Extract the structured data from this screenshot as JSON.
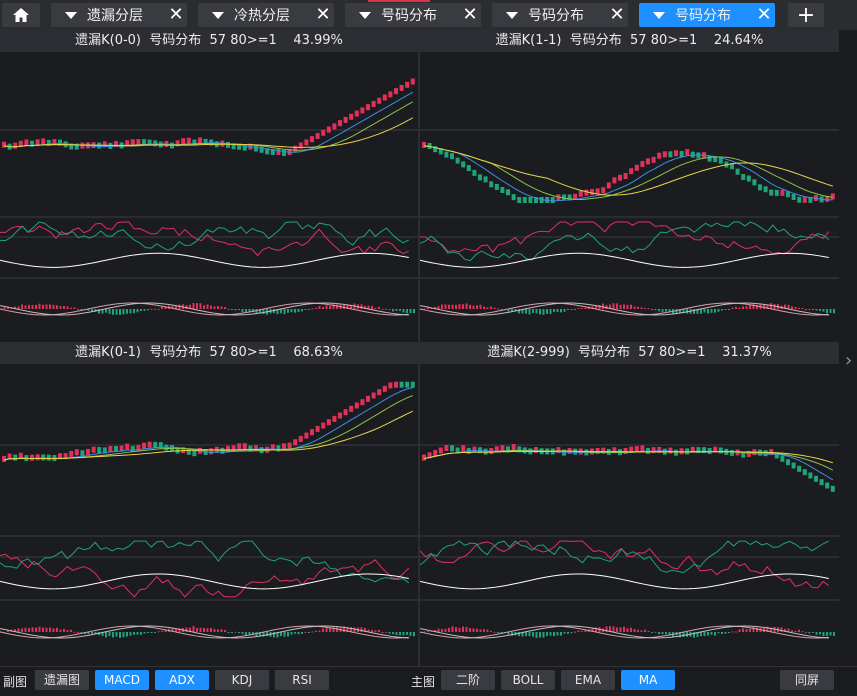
{
  "tabs": [
    {
      "label": "遗漏分层",
      "active": false
    },
    {
      "label": "冷热分层",
      "active": false
    },
    {
      "label": "号码分布",
      "active": false
    },
    {
      "label": "号码分布",
      "active": false
    },
    {
      "label": "号码分布",
      "active": true
    }
  ],
  "home_icon": "home-icon",
  "add_tab_symbol": "+",
  "close_symbol": "✕",
  "panes": [
    {
      "title": "遗漏K(0-0)  号码分布  57 80>=1    43.99%"
    },
    {
      "title": "遗漏K(1-1)  号码分布  57 80>=1    24.64%"
    },
    {
      "title": "遗漏K(0-1)  号码分布  57 80>=1    68.63%"
    },
    {
      "title": "遗漏K(2-999)  号码分布  57 80>=1    31.37%"
    }
  ],
  "bottom": {
    "sub_label": "副图",
    "sub_buttons": [
      {
        "label": "遗漏图",
        "on": false
      },
      {
        "label": "MACD",
        "on": true
      },
      {
        "label": "ADX",
        "on": true
      },
      {
        "label": "KDJ",
        "on": false
      },
      {
        "label": "RSI",
        "on": false
      }
    ],
    "main_label": "主图",
    "main_buttons": [
      {
        "label": "二阶",
        "on": false
      },
      {
        "label": "BOLL",
        "on": false
      },
      {
        "label": "EMA",
        "on": false
      },
      {
        "label": "MA",
        "on": true
      }
    ],
    "split_label": "同屏"
  },
  "colors": {
    "accent": "#1e90ff",
    "up": "#e0315a",
    "down": "#1fa37a",
    "ma_yellow": "#e8d44a",
    "ma_blue": "#3a8ee8",
    "ma_green": "#8bc34a"
  }
}
